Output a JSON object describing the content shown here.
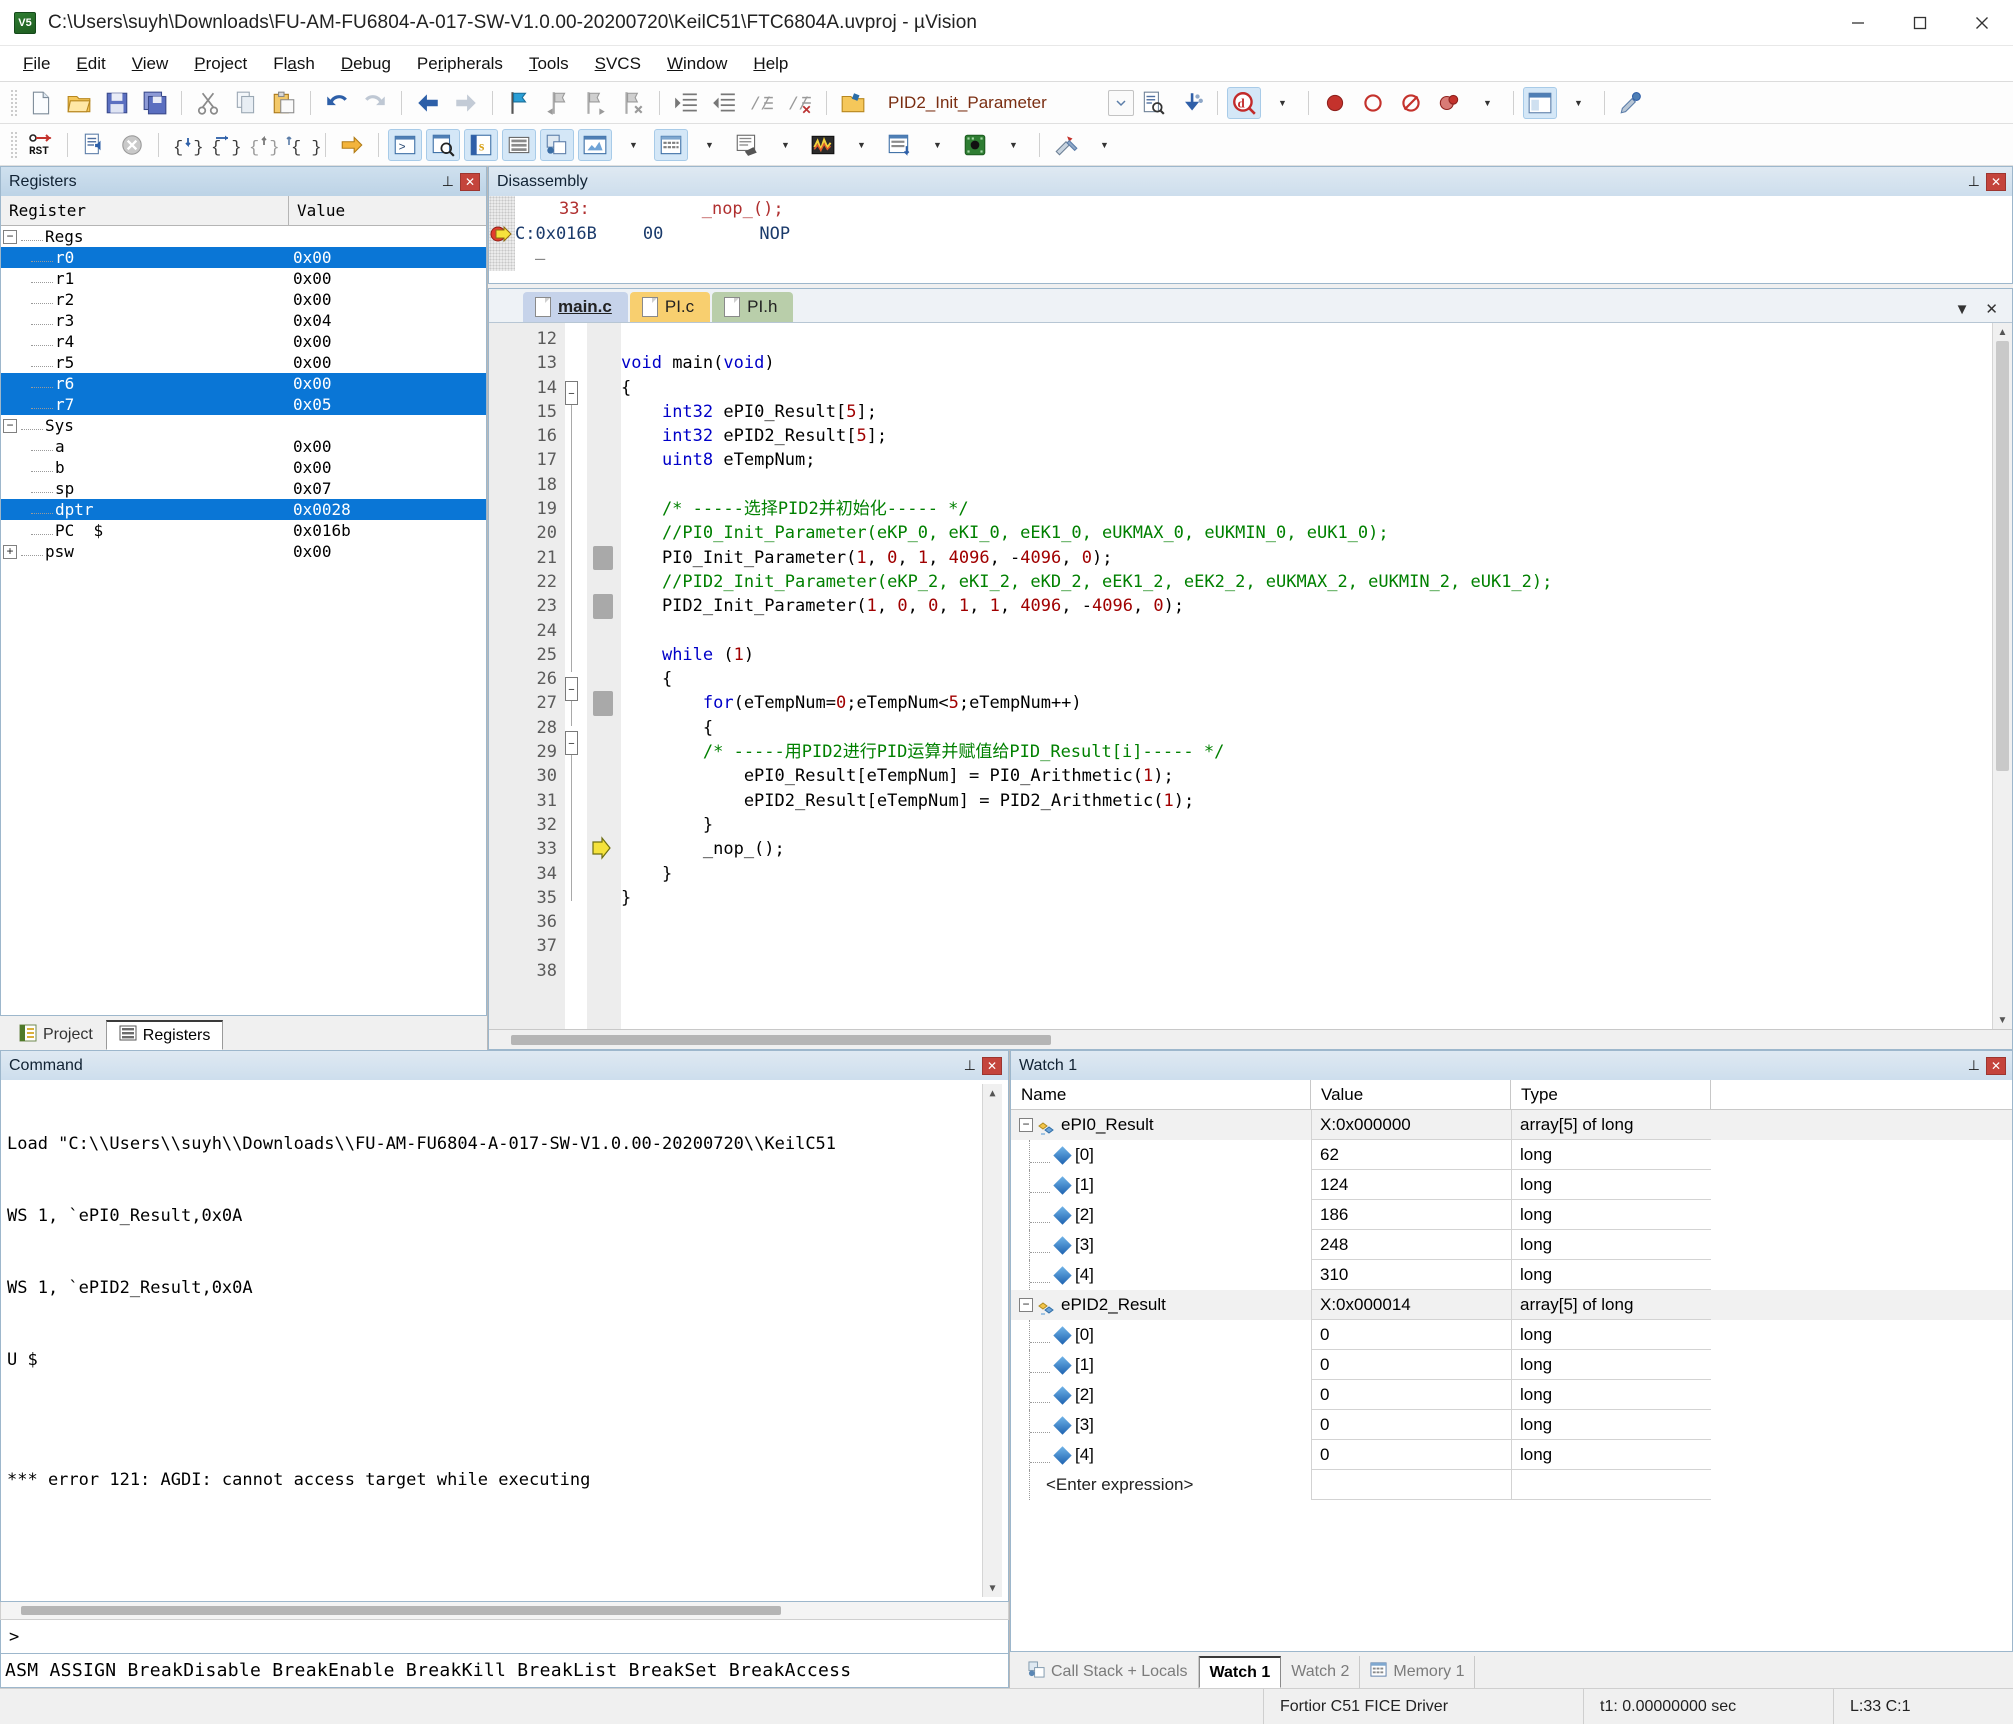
{
  "window": {
    "title": "C:\\Users\\suyh\\Downloads\\FU-AM-FU6804-A-017-SW-V1.0.00-20200720\\KeilC51\\FTC6804A.uvproj - µVision",
    "app_icon": "uvision-icon",
    "minimize": "minimize-button",
    "maximize": "maximize-button",
    "close": "close-button"
  },
  "menubar": [
    {
      "label": "File",
      "accel": "F"
    },
    {
      "label": "Edit",
      "accel": "E"
    },
    {
      "label": "View",
      "accel": "V"
    },
    {
      "label": "Project",
      "accel": "P"
    },
    {
      "label": "Flash",
      "accel": "a"
    },
    {
      "label": "Debug",
      "accel": "D"
    },
    {
      "label": "Peripherals",
      "accel": "r"
    },
    {
      "label": "Tools",
      "accel": "T"
    },
    {
      "label": "SVCS",
      "accel": "S"
    },
    {
      "label": "Window",
      "accel": "W"
    },
    {
      "label": "Help",
      "accel": "H"
    }
  ],
  "toolbar_main": {
    "combo_value": "PID2_Init_Parameter",
    "icons": [
      "new-file-icon",
      "open-file-icon",
      "save-icon",
      "save-all-icon",
      "cut-icon",
      "copy-icon",
      "paste-icon",
      "undo-icon",
      "redo-icon",
      "navigate-back-icon",
      "navigate-forward-icon",
      "bookmark-toggle-icon",
      "bookmark-prev-icon",
      "bookmark-next-icon",
      "bookmark-clear-icon",
      "indent-icon",
      "outdent-icon",
      "comment-icon",
      "uncomment-icon",
      "function-browse-icon",
      "combo-dropdown-icon",
      "find-in-files-icon",
      "insert-template-icon",
      "debug-session-icon",
      "debug-dropdown-icon"
    ]
  },
  "toolbar_debug": {
    "icons": [
      "reset-icon",
      "run-icon",
      "stop-icon",
      "step-into-icon",
      "step-over-icon",
      "step-out-icon",
      "run-to-cursor-icon",
      "show-next-statement-icon",
      "command-window-icon",
      "disassembly-window-icon",
      "symbols-window-icon",
      "registers-window-icon",
      "call-stack-icon",
      "watch-windows-icon",
      "memory-windows-icon",
      "serial-windows-icon",
      "analysis-windows-icon",
      "trace-windows-icon",
      "system-viewer-icon",
      "toolbox-icon"
    ]
  },
  "registers": {
    "title": "Registers",
    "columns": [
      "Register",
      "Value"
    ],
    "groups": [
      {
        "name": "Regs",
        "expanded": true,
        "rows": [
          {
            "name": "r0",
            "value": "0x00",
            "selected": true
          },
          {
            "name": "r1",
            "value": "0x00",
            "selected": false
          },
          {
            "name": "r2",
            "value": "0x00",
            "selected": false
          },
          {
            "name": "r3",
            "value": "0x04",
            "selected": false
          },
          {
            "name": "r4",
            "value": "0x00",
            "selected": false
          },
          {
            "name": "r5",
            "value": "0x00",
            "selected": false
          },
          {
            "name": "r6",
            "value": "0x00",
            "selected": true
          },
          {
            "name": "r7",
            "value": "0x05",
            "selected": true
          }
        ]
      },
      {
        "name": "Sys",
        "expanded": true,
        "rows": [
          {
            "name": "a",
            "value": "0x00",
            "selected": false
          },
          {
            "name": "b",
            "value": "0x00",
            "selected": false
          },
          {
            "name": "sp",
            "value": "0x07",
            "selected": false
          },
          {
            "name": "dptr",
            "value": "0x0028",
            "selected": true
          },
          {
            "name": "PC  $",
            "value": "0x016b",
            "selected": false
          },
          {
            "name": "psw",
            "value": "0x00",
            "selected": false,
            "expandable": true
          }
        ]
      }
    ]
  },
  "left_tabs": [
    {
      "label": "Project",
      "icon": "project-icon",
      "active": false
    },
    {
      "label": "Registers",
      "icon": "registers-icon",
      "active": true
    }
  ],
  "disassembly": {
    "title": "Disassembly",
    "lines": [
      {
        "kind": "source",
        "num": "33:",
        "text": "_nop_();"
      },
      {
        "kind": "asm",
        "addr": "C:0x016B",
        "bytes": "00",
        "mnemonic": "NOP",
        "pc": true
      }
    ]
  },
  "editor": {
    "tabs": [
      {
        "label": "main.c",
        "active": true
      },
      {
        "label": "PI.c",
        "active": false
      },
      {
        "label": "PI.h",
        "active": false
      }
    ],
    "first_line": 12,
    "lines": [
      {
        "n": 12,
        "code": ""
      },
      {
        "n": 13,
        "code": "void main(void)"
      },
      {
        "n": 14,
        "code": "{",
        "fold": "open"
      },
      {
        "n": 15,
        "code": "    int32 ePI0_Result[5];"
      },
      {
        "n": 16,
        "code": "    int32 ePID2_Result[5];"
      },
      {
        "n": 17,
        "code": "    uint8 eTempNum;"
      },
      {
        "n": 18,
        "code": ""
      },
      {
        "n": 19,
        "code": "    /* -----选择PID2并初始化----- */"
      },
      {
        "n": 20,
        "code": "    //PI0_Init_Parameter(eKP_0, eKI_0, eEK1_0, eUKMAX_0, eUKMIN_0, eUK1_0);"
      },
      {
        "n": 21,
        "code": "    PI0_Init_Parameter(1, 0, 1, 4096, -4096, 0);",
        "bp": true
      },
      {
        "n": 22,
        "code": "    //PID2_Init_Parameter(eKP_2, eKI_2, eKD_2, eEK1_2, eEK2_2, eUKMAX_2, eUKMIN_2, eUK1_2);"
      },
      {
        "n": 23,
        "code": "    PID2_Init_Parameter(1, 0, 0, 1, 1, 4096, -4096, 0);",
        "bp": true
      },
      {
        "n": 24,
        "code": ""
      },
      {
        "n": 25,
        "code": "    while (1)"
      },
      {
        "n": 26,
        "code": "    {",
        "fold": "open"
      },
      {
        "n": 27,
        "code": "        for(eTempNum=0;eTempNum<5;eTempNum++)",
        "bp": true
      },
      {
        "n": 28,
        "code": "        {",
        "fold": "open"
      },
      {
        "n": 29,
        "code": "        /* -----用PID2进行PID运算并赋值给PID_Result[i]----- */"
      },
      {
        "n": 30,
        "code": "            ePI0_Result[eTempNum] = PI0_Arithmetic(1);"
      },
      {
        "n": 31,
        "code": "            ePID2_Result[eTempNum] = PID2_Arithmetic(1);"
      },
      {
        "n": 32,
        "code": "        }",
        "fold": "end"
      },
      {
        "n": 33,
        "code": "        _nop_();",
        "pc": true
      },
      {
        "n": 34,
        "code": "    }",
        "fold": "end"
      },
      {
        "n": 35,
        "code": "}",
        "fold": "end"
      },
      {
        "n": 36,
        "code": ""
      },
      {
        "n": 37,
        "code": ""
      },
      {
        "n": 38,
        "code": ""
      }
    ]
  },
  "command": {
    "title": "Command",
    "lines": [
      "Load \"C:\\\\Users\\\\suyh\\\\Downloads\\\\FU-AM-FU6804-A-017-SW-V1.0.00-20200720\\\\KeilC51",
      "WS 1, `ePI0_Result,0x0A",
      "WS 1, `ePID2_Result,0x0A",
      "U $",
      "",
      "*** error 121: AGDI: cannot access target while executing"
    ],
    "prompt": ">",
    "input_value": "",
    "help_line": "ASM ASSIGN BreakDisable BreakEnable BreakKill BreakList BreakSet BreakAccess"
  },
  "watch": {
    "title": "Watch 1",
    "columns": [
      "Name",
      "Value",
      "Type"
    ],
    "rows": [
      {
        "name": "ePI0_Result",
        "value": "X:0x000000",
        "type": "array[5] of long",
        "level": 0,
        "group": true
      },
      {
        "name": "[0]",
        "value": "62",
        "type": "long",
        "level": 1,
        "group": false
      },
      {
        "name": "[1]",
        "value": "124",
        "type": "long",
        "level": 1,
        "group": false
      },
      {
        "name": "[2]",
        "value": "186",
        "type": "long",
        "level": 1,
        "group": false
      },
      {
        "name": "[3]",
        "value": "248",
        "type": "long",
        "level": 1,
        "group": false
      },
      {
        "name": "[4]",
        "value": "310",
        "type": "long",
        "level": 1,
        "group": false
      },
      {
        "name": "ePID2_Result",
        "value": "X:0x000014",
        "type": "array[5] of long",
        "level": 0,
        "group": true
      },
      {
        "name": "[0]",
        "value": "0",
        "type": "long",
        "level": 1,
        "group": false
      },
      {
        "name": "[1]",
        "value": "0",
        "type": "long",
        "level": 1,
        "group": false
      },
      {
        "name": "[2]",
        "value": "0",
        "type": "long",
        "level": 1,
        "group": false
      },
      {
        "name": "[3]",
        "value": "0",
        "type": "long",
        "level": 1,
        "group": false
      },
      {
        "name": "[4]",
        "value": "0",
        "type": "long",
        "level": 1,
        "group": false
      },
      {
        "name": "<Enter expression>",
        "value": "",
        "type": "",
        "level": 1,
        "group": false,
        "placeholder": true
      }
    ]
  },
  "bottom_tabs": [
    {
      "label": "Call Stack + Locals",
      "icon": "call-stack-icon",
      "active": false
    },
    {
      "label": "Watch 1",
      "icon": "",
      "active": true
    },
    {
      "label": "Watch 2",
      "icon": "",
      "active": false
    },
    {
      "label": "Memory 1",
      "icon": "memory-icon",
      "active": false
    }
  ],
  "statusbar": {
    "driver": "Fortior C51 FICE Driver",
    "time": "t1: 0.00000000 sec",
    "cursor": "L:33 C:1"
  },
  "colors": {
    "selection_blue": "#0a76d6",
    "keyword": "#0000c8",
    "comment": "#008000",
    "number": "#a00000",
    "panel_header": "#bcd3e6",
    "close_red": "#c4443c",
    "tab_main": "#c6d3ea",
    "tab_plc": "#f8cf6f",
    "tab_plh": "#b9ceaa"
  }
}
